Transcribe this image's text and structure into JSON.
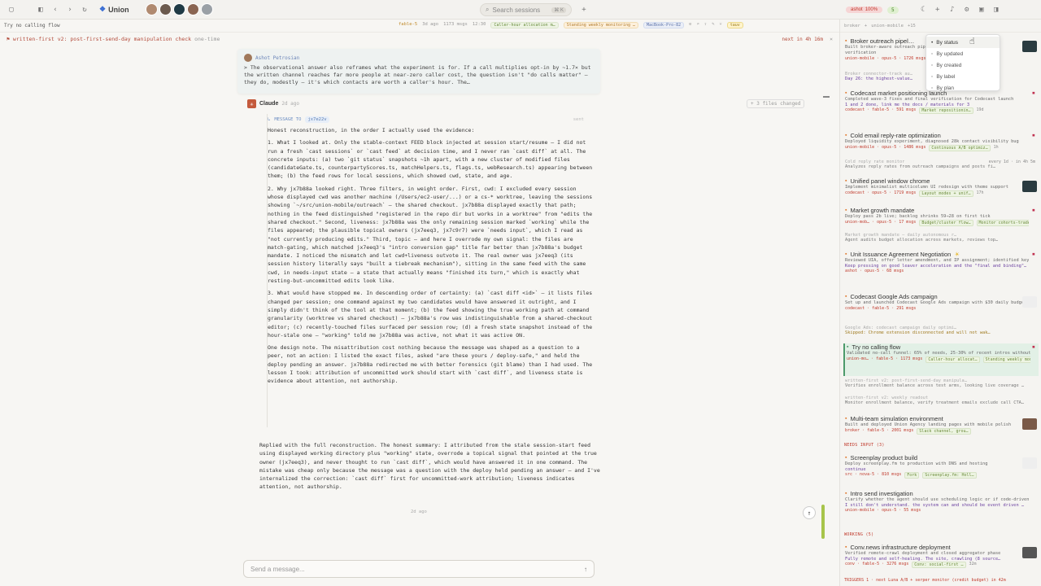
{
  "topbar": {
    "brand": "Union",
    "search_placeholder": "Search sessions",
    "search_kbd": "⌘ K",
    "user_badge": "ashot",
    "user_pct": "100%",
    "status_count": "5"
  },
  "subheader": {
    "title": "Try no calling flow",
    "meta": [
      "fable-5",
      "3d ago",
      "1173 msgs",
      "12:30"
    ],
    "pills": [
      "Caller-hour allocation m…",
      "Standing weekly monitoring …",
      "MacBook-Pro-82"
    ],
    "branch": "tauv"
  },
  "flagbar": {
    "title": "written-first v2: post-first-send-day manipulation check",
    "tag": "one-time",
    "right": "next in 4h 16m"
  },
  "quote": {
    "author": "Ashot Petrosian",
    "text": "> The observational answer also reframes what the experiment is for. If a call multiplies opt-in by ~1.7× but the written channel reaches far more people at near-zero caller cost, the question isn't \"do calls matter\" — they do, modestly — it's which contacts are worth a caller's hour. The…"
  },
  "claude": {
    "name": "Claude",
    "time": "2d ago",
    "files_changed": "+ 3 files changed"
  },
  "message": {
    "header": "MESSAGE TO",
    "target": "jx7e22v",
    "status": "sent",
    "intro": "Honest reconstruction, in the order I actually used the evidence:",
    "p1": "1. What I looked at. Only the stable-context FEED block injected at session start/resume — I did not run a fresh `cast sessions` or `cast feed` at decision time, and I never ran `cast diff` at all. The concrete inputs: (a) two `git status` snapshots ~1h apart, with a new cluster of modified files (candidateGate.ts, counterpartyScores.ts, matchHelpers.ts, flags.ts, webResearch.ts) appearing between them; (b) the feed rows for local sessions, which showed cwd, state, and age.",
    "p2": "2. Why jx7b88a looked right. Three filters, in weight order. First, cwd: I excluded every session whose displayed cwd was another machine (/Users/ec2-user/...) or a cs-* worktree, leaving the sessions showing `~/src/union-mobile/outreach` — the shared checkout. jx7b88a displayed exactly that path; nothing in the feed distinguished \"registered in the repo dir but works in a worktree\" from \"edits the shared checkout.\" Second, liveness: jx7b88a was the only remaining session marked `working` while the files appeared; the plausible topical owners (jx7eeq3, jx7c9r7) were `needs input`, which I read as \"not currently producing edits.\" Third, topic — and here I overrode my own signal: the files are match-gating, which matched jx7eeq3's \"intro conversion gap\" title far better than jx7b88a's budget mandate. I noticed the mismatch and let cwd+liveness outvote it. The real owner was jx7eeq3 (its session history literally says \"built a tiebreak mechanism\"), sitting in the same feed with the same cwd, in needs-input state — a state that actually means \"finished its turn,\" which is exactly what resting-but-uncommitted edits look like.",
    "p3": "3. What would have stopped me. In descending order of certainty: (a) `cast diff <id>` — it lists files changed per session; one command against my two candidates would have answered it outright, and I simply didn't think of the tool at that moment; (b) the feed showing the true working path at command granularity (worktree vs shared checkout) — jx7b88a's row was indistinguishable from a shared-checkout editor; (c) recently-touched files surfaced per session row; (d) a fresh state snapshot instead of the hour-stale one — \"working\" told me jx7b88a was active, not what it was active ON.",
    "p4": "One design note. The misattribution cost nothing because the message was shaped as a question to a peer, not an action: I listed the exact files, asked \"are these yours / deploy-safe,\" and held the deploy pending an answer. jx7b88a redirected me with better forensics (git blame) than I had used. The lesson I took: attribution of uncommitted work should start with `cast diff`, and liveness state is evidence about attention, not authorship."
  },
  "reply": "Replied with the full reconstruction. The honest summary: I attributed from the stale session-start feed using displayed working directory plus \"working\" state, overrode a topical signal that pointed at the true owner (jx7eeq3), and never thought to run `cast diff`, which would have answered it in one command. The mistake was cheap only because the message was a question with the deploy held pending an answer — and I've internalized the correction: `cast diff` first for uncommitted-work attribution; liveness indicates attention, not authorship.",
  "day_label": "2d ago",
  "composer": {
    "placeholder": "Send a message..."
  },
  "dropdown": {
    "options": [
      "By status",
      "By updated",
      "By created",
      "By label",
      "By plan"
    ]
  },
  "sidebar": {
    "tabs": [
      "broker",
      "union-mobile",
      "+15"
    ],
    "sections": {
      "needs_input": "NEEDS INPUT (3)",
      "working": "WORKING (5)"
    },
    "items": [
      {
        "title": "Broker outreach pipel…",
        "desc": "Built broker-aware outreach pipeline…",
        "desc2": "verification",
        "meta": "union-mobile · opus-5 · 1726 msgs"
      },
      {
        "title": "Broker connector-track au…",
        "desc": "Day 26: the highest-value…",
        "meta": ""
      },
      {
        "title": "Codecast market positioning launch",
        "desc": "Completed wave-3 fixes and final verification for Codecast launch",
        "desc2": "1 and 2 done, link me the docs / materials for 3",
        "meta": "codecast · fable-5 · 591 msgs",
        "tag": "Market repositionin…",
        "time": "19d"
      },
      {
        "title": "Cold email reply-rate optimization",
        "desc": "Deployed liquidity experiment, diagnosed 28k contact visibility bug",
        "meta": "union-mobile · opus-5 · 1486 msgs",
        "tag": "Continuous A/B optimiz…",
        "time": "1h"
      },
      {
        "title": "Cold reply rate monitor",
        "desc": "Analyzes reply rates from outreach campaigns and posts fi…",
        "meta": "every 1d · in 4h 5m"
      },
      {
        "title": "Unified panel window chrome",
        "desc": "Implement minimalist multicolumn UI redesign with theme support",
        "meta": "codecast · opus-5 · 1719 msgs",
        "tag": "Layout modes + unif…",
        "time": "17h"
      },
      {
        "title": "Market growth mandate",
        "desc": "Deploy pass 2b live; backlog shrinks 59→28 on first tick",
        "meta": "union-mob… · opus-5 · 17 msgs",
        "tag": "Budget/cluster flow…",
        "tag2": "Monitor cohorts-trades…"
      },
      {
        "title": "Market growth mandate — daily autonomous r…",
        "desc": "Agent audits budget allocation across markets, reviews top…",
        "meta": "every 1d · in 17h 15m"
      },
      {
        "title": "Unit Issuance Agreement Negotiation",
        "desc": "Reviewed UIA, offer letter amendment, and IP assignment; identified key gaps",
        "desc2": "Keep pressing on good leaver acceleration and the \"final and binding\"…",
        "meta": "ashot · opus-5 · 68 msgs"
      },
      {
        "title": "Codecast Google Ads campaign",
        "desc": "Set up and launched Codecast Google Ads campaign with $30 daily budget",
        "meta": "codecast · fable-5 · 291 msgs"
      },
      {
        "title": "Google Ads: codecast campaign daily optimi…",
        "desc": "Skipped: Chrome extension disconnected and will not wak…",
        "meta": "every 1d · 17h 6m"
      },
      {
        "title": "Try no calling flow",
        "desc": "Validated no-call funnel: 65% of needs, 25-30% of recent intros without calls",
        "meta": "union-mo… · fable-5 · 1173 msgs",
        "tag": "Caller-hour allocat…",
        "tag2": "Standing weekly monitor…"
      },
      {
        "title": "written-first v2: post-first-send-day manipula…",
        "desc": "Verifies enrollment balance across test arms, looking live coverage …",
        "meta": "one-time · in 4h 16m"
      },
      {
        "title": "written-first v2: weekly readout",
        "desc": "Monitor enrollment balance, verify treatment emails exclude call CTA…",
        "meta": "every 7d · in 3d 5h"
      },
      {
        "title": "Multi-team simulation environment",
        "desc": "Built and deployed Union Agency landing pages with mobile polish",
        "meta": "broker · fable-5 · 2001 msgs",
        "tag": "Slack channel, grou…"
      },
      {
        "title": "Screenplay product build",
        "desc": "Deploy screenplay.fm to production with DNS and hosting",
        "desc2": "continue",
        "meta": "src · nova-5 · 810 msgs",
        "tag": "Fork",
        "tag2": "Screenplay.fm: Holl…"
      },
      {
        "title": "Intro send investigation",
        "desc": "Clarify whether the agent should use scheduling logic or if code-driven triggers remain the intended design.",
        "desc2": "I still don't understand. the system can and should be event driven …",
        "meta": "union-mobile · opus-5 · 55 msgs"
      },
      {
        "title": "Conv.news infrastructure deployment",
        "desc": "Verified remote-crawl deployment and closed aggregator phase",
        "desc2": "Fully remote and self-healing. The site, crawling (8 source…",
        "meta": "conv · fable-5 · 3276 msgs",
        "tag": "Conv: social-first …",
        "time": "32m"
      }
    ],
    "triggers": "TRIGGERS 1 · next Luna A/B + serper monitor (credit budget) in 42m"
  }
}
